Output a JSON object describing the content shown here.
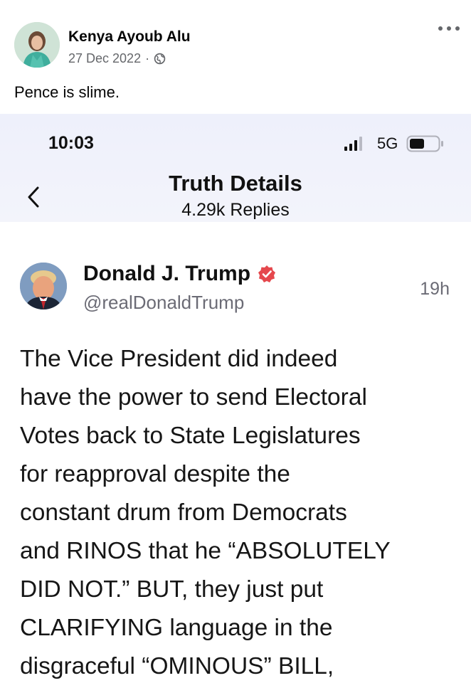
{
  "post": {
    "author_name": "Kenya Ayoub Alu",
    "date": "27 Dec 2022",
    "separator": "·",
    "caption": "Pence is slime."
  },
  "embedded": {
    "status_bar": {
      "time": "10:03",
      "network": "5G"
    },
    "nav": {
      "title": "Truth Details",
      "subtitle": "4.29k Replies"
    },
    "truth": {
      "author_name": "Donald J. Trump",
      "handle": "@realDonaldTrump",
      "age": "19h",
      "lines": [
        "The Vice President did indeed",
        "have the power to send Electoral",
        "Votes back to State Legislatures",
        "for reapproval despite the",
        "constant drum from Democrats",
        "and RINOS that he “ABSOLUTELY",
        "DID NOT.” BUT, they just put",
        "CLARIFYING language in the",
        "disgraceful “OMINOUS” BILL,"
      ]
    }
  },
  "colors": {
    "verified_badge": "#e5484d",
    "secondary_text": "#65676b",
    "header_background": "#eef0fb"
  },
  "icons": {
    "privacy": "globe-icon",
    "menu": "more-options-icon",
    "back": "chevron-left-icon",
    "verified": "verified-badge-icon"
  }
}
